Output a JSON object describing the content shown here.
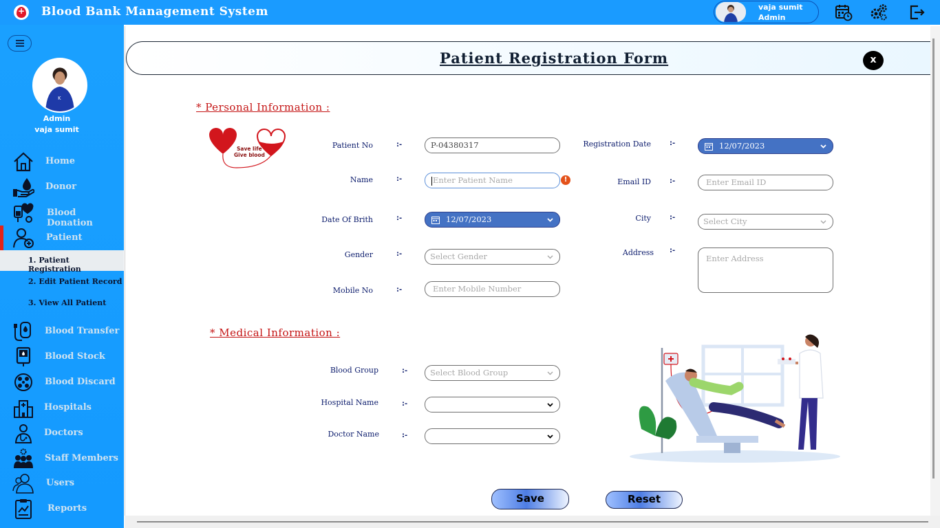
{
  "app": {
    "title": "Blood Bank Management System"
  },
  "user": {
    "name": "vaja sumit",
    "role": "Admin"
  },
  "sidebar": {
    "profile": {
      "role": "Admin",
      "name": "vaja sumit"
    },
    "items": [
      {
        "label": "Home",
        "icon": "home-icon"
      },
      {
        "label": "Donor",
        "icon": "donor-icon"
      },
      {
        "label": "Blood Donation",
        "icon": "blood-donation-icon"
      },
      {
        "label": "Patient",
        "icon": "patient-icon"
      },
      {
        "label": "Blood Transfer",
        "icon": "blood-transfer-icon"
      },
      {
        "label": "Blood Stock",
        "icon": "blood-stock-icon"
      },
      {
        "label": "Blood Discard",
        "icon": "blood-discard-icon"
      },
      {
        "label": "Hospitals",
        "icon": "hospital-icon"
      },
      {
        "label": "Doctors",
        "icon": "doctor-icon"
      },
      {
        "label": "Staff Members",
        "icon": "staff-icon"
      },
      {
        "label": "Users",
        "icon": "users-icon"
      },
      {
        "label": "Reports",
        "icon": "reports-icon"
      }
    ],
    "patient_submenu": [
      {
        "label": "1.  Patient Registration",
        "selected": true
      },
      {
        "label": "2.  Edit Patient Record",
        "selected": false
      },
      {
        "label": "3.  View All Patient",
        "selected": false
      }
    ]
  },
  "form": {
    "title": "Patient Registration  Form",
    "close_label": "x",
    "personal_section": "*  Personal Information  :",
    "medical_section": "*  Medical Information  :",
    "separator": ":-",
    "logo_text_line1": "Save life",
    "logo_text_line2": "Give blood",
    "patient_no": {
      "label": "Patient No",
      "value": "P-04380317"
    },
    "name": {
      "label": "Name",
      "placeholder": "Enter Patient Name",
      "error_icon": "!"
    },
    "dob": {
      "label": "Date Of Brith",
      "value": "12/07/2023"
    },
    "gender": {
      "label": "Gender",
      "placeholder": "Select Gender"
    },
    "mobile": {
      "label": "Mobile No",
      "placeholder": "Enter Mobile Number"
    },
    "reg_date": {
      "label": "Registration Date",
      "value": "12/07/2023"
    },
    "email": {
      "label": "Email ID",
      "placeholder": "Enter Email ID"
    },
    "city": {
      "label": "City",
      "placeholder": "Select City"
    },
    "address": {
      "label": "Address",
      "placeholder": "Enter Address"
    },
    "blood_group": {
      "label": "Blood Group",
      "placeholder": "Select Blood Group"
    },
    "hospital": {
      "label": "Hospital Name",
      "value": ""
    },
    "doctor": {
      "label": "Doctor Name",
      "value": ""
    },
    "save_label": "Save",
    "reset_label": "Reset"
  },
  "colors": {
    "topbar": "#1a9bff",
    "sidebar": "#1aa0ff",
    "accent_red": "#c41414",
    "date_fill": "#4472c4",
    "label_text": "#0a1a6b"
  }
}
